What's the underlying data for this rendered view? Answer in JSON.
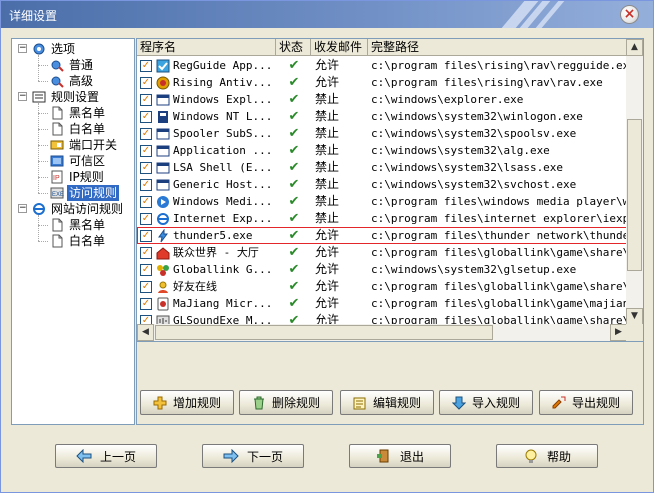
{
  "window": {
    "title": "详细设置",
    "close_icon": "close-icon",
    "close_glyph": "×"
  },
  "tree": {
    "nodes": [
      {
        "label": "选项",
        "icon": "options-gear-icon",
        "expanded": true
      },
      {
        "label": "普通",
        "icon": "gear-small-icon"
      },
      {
        "label": "高级",
        "icon": "gear-small-icon"
      },
      {
        "label": "规则设置",
        "icon": "rules-settings-icon",
        "expanded": true
      },
      {
        "label": "黑名单",
        "icon": "document-icon"
      },
      {
        "label": "白名单",
        "icon": "document-icon"
      },
      {
        "label": "端口开关",
        "icon": "port-switch-icon"
      },
      {
        "label": "可信区",
        "icon": "trusted-zone-icon"
      },
      {
        "label": "IP规则",
        "icon": "ip-rules-icon"
      },
      {
        "label": "访问规则",
        "icon": "exe-access-rules-icon",
        "selected": true
      },
      {
        "label": "网站访问规则",
        "icon": "ie-browser-icon",
        "expanded": true
      },
      {
        "label": "黑名单",
        "icon": "document-icon"
      },
      {
        "label": "白名单",
        "icon": "document-icon"
      }
    ]
  },
  "list": {
    "columns": [
      "程序名",
      "状态",
      "收发邮件",
      "完整路径"
    ],
    "rows": [
      {
        "name": "RegGuide App...",
        "icon": "regguide-icon",
        "status": "✔",
        "mail": "允许",
        "path": "c:\\program files\\rising\\rav\\regguide.exe"
      },
      {
        "name": "Rising Antiv...",
        "icon": "rising-antivirus-icon",
        "status": "✔",
        "mail": "允许",
        "path": "c:\\program files\\rising\\rav\\rav.exe"
      },
      {
        "name": "Windows Expl...",
        "icon": "window-app-icon",
        "status": "✔",
        "mail": "禁止",
        "path": "c:\\windows\\explorer.exe"
      },
      {
        "name": "Windows NT L...",
        "icon": "winlogon-icon",
        "status": "✔",
        "mail": "禁止",
        "path": "c:\\windows\\system32\\winlogon.exe"
      },
      {
        "name": "Spooler SubS...",
        "icon": "window-app-icon",
        "status": "✔",
        "mail": "禁止",
        "path": "c:\\windows\\system32\\spoolsv.exe"
      },
      {
        "name": "Application ...",
        "icon": "window-app-icon",
        "status": "✔",
        "mail": "禁止",
        "path": "c:\\windows\\system32\\alg.exe"
      },
      {
        "name": "LSA Shell (E...",
        "icon": "window-app-icon",
        "status": "✔",
        "mail": "禁止",
        "path": "c:\\windows\\system32\\lsass.exe"
      },
      {
        "name": "Generic Host...",
        "icon": "window-app-icon",
        "status": "✔",
        "mail": "禁止",
        "path": "c:\\windows\\system32\\svchost.exe"
      },
      {
        "name": "Windows Medi...",
        "icon": "media-player-icon",
        "status": "✔",
        "mail": "禁止",
        "path": "c:\\program files\\windows media player\\wmp..."
      },
      {
        "name": "Internet Exp...",
        "icon": "ie-browser-icon",
        "status": "✔",
        "mail": "禁止",
        "path": "c:\\program files\\internet explorer\\iexplo..."
      },
      {
        "name": "thunder5.exe",
        "icon": "thunder-icon",
        "status": "✔",
        "mail": "允许",
        "path": "c:\\program files\\thunder network\\thunder\\...",
        "highlight": true
      },
      {
        "name": "联众世界 - 大厅",
        "icon": "ourgame-home-icon",
        "status": "✔",
        "mail": "允许",
        "path": "c:\\program files\\globallink\\game\\share\\gl..."
      },
      {
        "name": "Globallink G...",
        "icon": "globallink-icon",
        "status": "✔",
        "mail": "允许",
        "path": "c:\\windows\\system32\\glsetup.exe"
      },
      {
        "name": "好友在线",
        "icon": "friends-online-icon",
        "status": "✔",
        "mail": "允许",
        "path": "c:\\program files\\globallink\\game\\share\\ou..."
      },
      {
        "name": "MaJiang Micr...",
        "icon": "majiang-icon",
        "status": "✔",
        "mail": "允许",
        "path": "c:\\program files\\globallink\\game\\majiang\\..."
      },
      {
        "name": "GLSoundExe M...",
        "icon": "glsound-icon",
        "status": "✔",
        "mail": "允许",
        "path": "c:\\program files\\globallink\\game\\share\\gl..."
      }
    ],
    "check_glyph": "✓",
    "scroll_up": "▲",
    "scroll_down": "▼",
    "scroll_left": "◀",
    "scroll_right": "▶"
  },
  "actions": {
    "add_rule": "增加规则",
    "delete_rule": "删除规则",
    "edit_rule": "编辑规则",
    "import_rule": "导入规则",
    "export_rule": "导出规则"
  },
  "nav": {
    "prev": "上一页",
    "next": "下一页",
    "exit": "退出",
    "help": "帮助"
  },
  "colors": {
    "title_bar": "#4b6ea9",
    "selection": "#316ac5",
    "highlight_border": "#e2262a",
    "check_green": "#2a8a2a"
  }
}
